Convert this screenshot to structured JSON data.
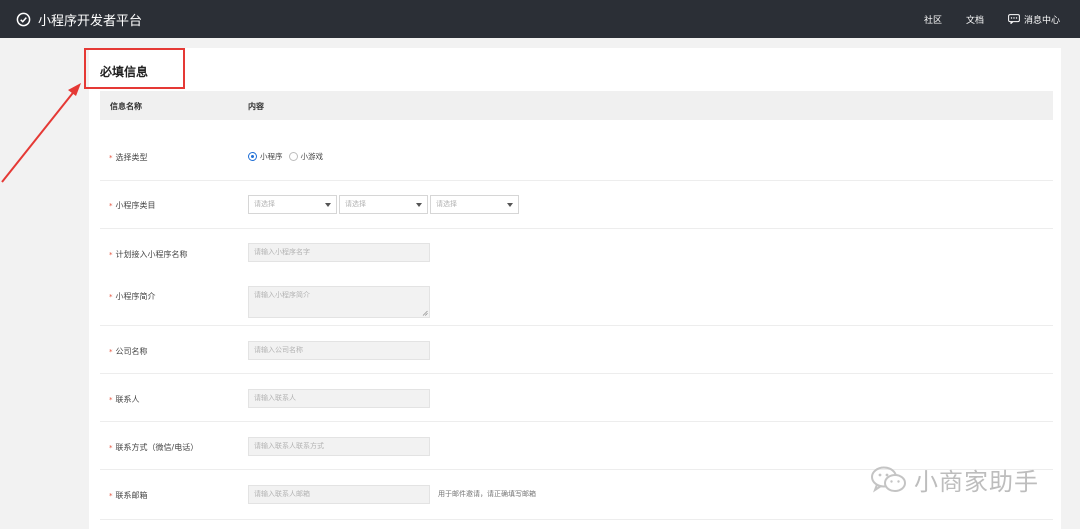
{
  "topbar": {
    "title": "小程序开发者平台",
    "nav": {
      "community": "社区",
      "docs": "文档",
      "messages": "消息中心"
    }
  },
  "form": {
    "section_title": "必填信息",
    "header": {
      "col_name": "信息名称",
      "col_content": "内容"
    },
    "type": {
      "label": "选择类型",
      "options": [
        "小程序",
        "小游戏"
      ],
      "selected": "小程序"
    },
    "category": {
      "label": "小程序类目",
      "placeholders": [
        "请选择",
        "请选择",
        "请选择"
      ]
    },
    "name": {
      "label": "计划接入小程序名称",
      "placeholder": "请输入小程序名字"
    },
    "intro": {
      "label": "小程序简介",
      "placeholder": "请输入小程序简介"
    },
    "company": {
      "label": "公司名称",
      "placeholder": "请输入公司名称"
    },
    "contact": {
      "label": "联系人",
      "placeholder": "请输入联系人"
    },
    "contact_method": {
      "label": "联系方式（微信/电话）",
      "placeholder": "请输入联系人联系方式"
    },
    "email": {
      "label": "联系邮箱",
      "placeholder": "请输入联系人邮箱",
      "hint": "用于邮件邀请，请正确填写邮箱"
    },
    "required_mark": "*"
  },
  "watermark": {
    "text": "小商家助手"
  },
  "colors": {
    "topbar_bg": "#2b2f36",
    "required": "#e5533d",
    "radio_on": "#1f6fd6",
    "annotation": "#e53935"
  }
}
